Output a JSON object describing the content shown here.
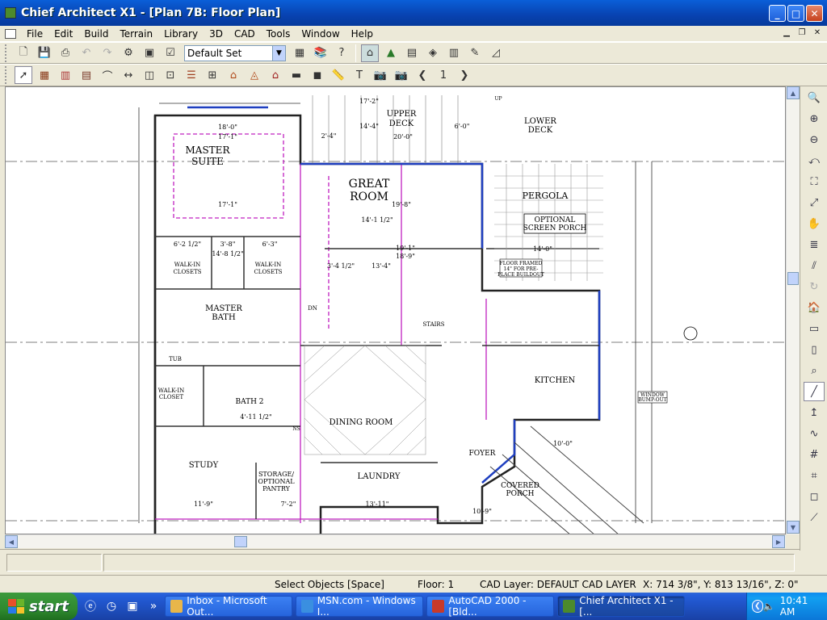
{
  "window": {
    "title": "Chief Architect X1 - [Plan 7B: Floor Plan]",
    "min_label": "_",
    "max_label": "□",
    "close_label": "✕"
  },
  "menu": {
    "items": [
      "File",
      "Edit",
      "Build",
      "Terrain",
      "Library",
      "3D",
      "CAD",
      "Tools",
      "Window",
      "Help"
    ]
  },
  "toolbar": {
    "layer_set_value": "Default Set"
  },
  "plan": {
    "rooms": {
      "master_suite": [
        "MASTER",
        "SUITE"
      ],
      "great_room": [
        "GREAT",
        "ROOM"
      ],
      "upper_deck": [
        "UPPER",
        "DECK"
      ],
      "lower_deck": [
        "LOWER",
        "DECK"
      ],
      "pergola": "PERGOLA",
      "optional_screen_porch": [
        "OPTIONAL",
        "SCREEN PORCH"
      ],
      "master_bath": [
        "MASTER",
        "BATH"
      ],
      "walk_in_closets_left": [
        "WALK-IN",
        "CLOSETS"
      ],
      "walk_in_closets_right": [
        "WALK-IN",
        "CLOSETS"
      ],
      "kitchen": "KITCHEN",
      "dining_room": "DINING ROOM",
      "bath_2": "BATH 2",
      "study": "STUDY",
      "storage": [
        "STORAGE/",
        "OPTIONAL",
        "PANTRY"
      ],
      "laundry": "LAUNDRY",
      "foyer": "FOYER",
      "covered_porch": [
        "COVERED",
        "PORCH"
      ],
      "walk_in_closet_small": [
        "WALK-IN",
        "CLOSET"
      ],
      "stairs": "STAIRS",
      "tub": "TUB"
    },
    "dimensions": {
      "d_17_2": "17'-2\"",
      "d_14_4": "14'-4\"",
      "d_18_0": "18'-0\"",
      "d_17_1_top": "17'-1\"",
      "d_17_1_bottom": "17'-1\"",
      "d_2_4": "2'-4\"",
      "d_20_0": "20'-0\"",
      "d_6_0": "6'-0\"",
      "d_19_8": "19'-8\"",
      "d_14_1_half": "14'-1 1/2\"",
      "d_18_9": "18'-9\"",
      "d_19_1": "19'-1\"",
      "d_13_4": "13'-4\"",
      "d_3_4_half": "3'-4 1/2\"",
      "d_14_0": "14'-0\"",
      "d_10_0": "10'-0\"",
      "d_11_9": "11'-9\"",
      "d_13_11": "13'-11\"",
      "d_7_2": "7'-2\"",
      "d_3_8": "3'-8\"",
      "d_14_8_half": "14'-8 1/2\"",
      "d_6_3": "6'-3\"",
      "d_6_21_2": "6'-2 1/2\"",
      "d_10_9": "10'-9\"",
      "d_4_11_half": "4'-11 1/2\""
    },
    "notes": {
      "window_bumpout": [
        "WINDOW",
        "BUMP-OUT"
      ],
      "floor_framed": [
        "FLOOR FRAMED",
        "14\" FOR PRE-",
        "PLACE BUILDOUT"
      ],
      "ns": "NS",
      "dn": "DN",
      "up": "UP"
    }
  },
  "status": {
    "mode": "Select Objects [Space]",
    "floor": "Floor: 1",
    "cad_layer": "CAD Layer:  DEFAULT CAD LAYER",
    "coords": "X: 714 3/8\", Y: 813 13/16\", Z: 0\""
  },
  "taskbar": {
    "start_label": "start",
    "tasks": [
      {
        "label": "Inbox - Microsoft Out...",
        "color": "#e8b64a"
      },
      {
        "label": "MSN.com - Windows I...",
        "color": "#3a8fe0"
      },
      {
        "label": "AutoCAD 2000 - [Bld...",
        "color": "#c83a2a"
      },
      {
        "label": "Chief Architect X1 - [...",
        "color": "#4c8a2c"
      }
    ],
    "time": "10:41 AM"
  }
}
